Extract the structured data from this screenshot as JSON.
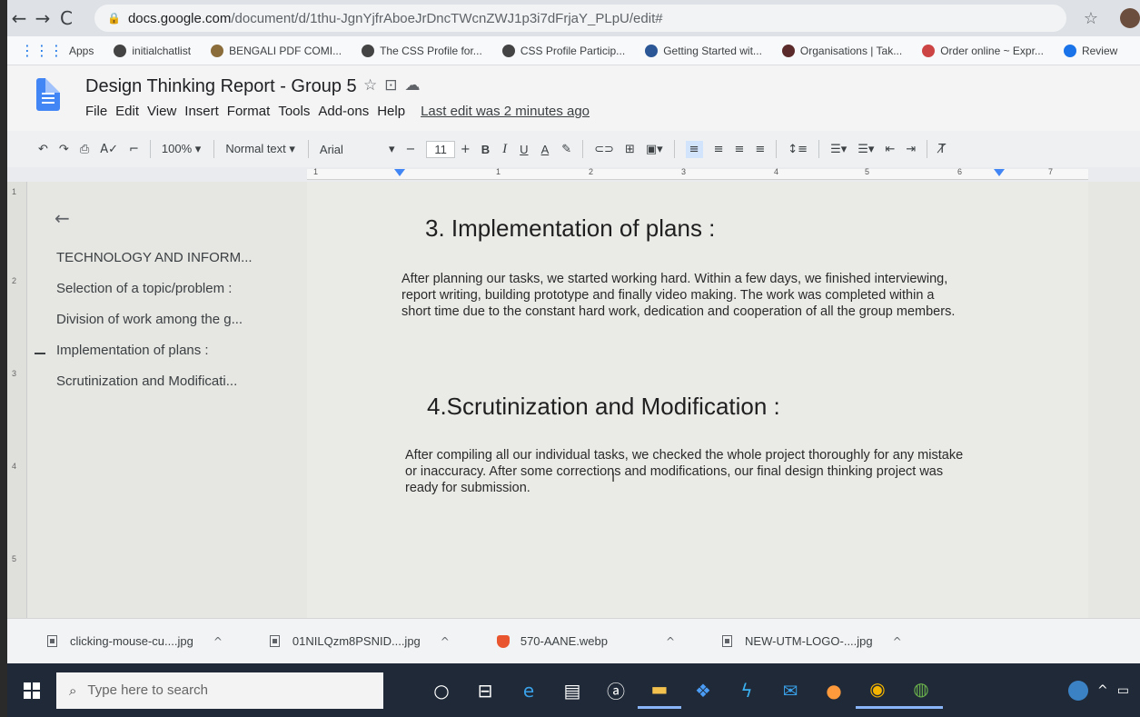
{
  "browser": {
    "url_host": "docs.google.com",
    "url_path": "/document/d/1thu-JgnYjfrAboeJrDncTWcnZWJ1p3i7dFrjaY_PLpU/edit#",
    "bookmarks": [
      {
        "label": "Apps",
        "icon": "apps-grid-icon"
      },
      {
        "label": "initialchatlist",
        "icon": "globe-icon"
      },
      {
        "label": "BENGALI PDF COMI...",
        "icon": "bookmark-icon"
      },
      {
        "label": "The CSS Profile for...",
        "icon": "globe-icon"
      },
      {
        "label": "CSS Profile Particip...",
        "icon": "globe-icon"
      },
      {
        "label": "Getting Started wit...",
        "icon": "bookmark-icon"
      },
      {
        "label": "Organisations | Tak...",
        "icon": "bookmark-icon"
      },
      {
        "label": "Order online ~ Expr...",
        "icon": "bookmark-icon"
      },
      {
        "label": "Review",
        "icon": "search-icon"
      }
    ]
  },
  "doc": {
    "title": "Design Thinking Report - Group 5",
    "menu": [
      "File",
      "Edit",
      "View",
      "Insert",
      "Format",
      "Tools",
      "Add-ons",
      "Help"
    ],
    "last_edit": "Last edit was 2 minutes ago"
  },
  "toolbar": {
    "zoom": "100%",
    "style": "Normal text",
    "font": "Arial",
    "font_size": "11",
    "bold": "B",
    "italic": "I",
    "underline": "U",
    "text_color": "A"
  },
  "ruler": {
    "numbers": [
      "1",
      "1",
      "2",
      "3",
      "4",
      "5",
      "6",
      "7"
    ]
  },
  "v_ruler": {
    "numbers": [
      "1",
      "2",
      "3",
      "4",
      "5"
    ]
  },
  "outline": {
    "items": [
      "TECHNOLOGY AND INFORM...",
      "Selection of a topic/problem :",
      "Division of work among the g...",
      "Implementation of plans :",
      "Scrutinization and Modificati..."
    ]
  },
  "content": {
    "h3": "3. Implementation of plans :",
    "p3_lines": [
      "After planning our tasks, we started working hard. Within a few days, we finished interviewing,",
      "report writing, building prototype and finally video making. The work was completed within a",
      "short time due to the constant hard work, dedication and cooperation of all the group members."
    ],
    "h4": "4.Scrutinization and Modification :",
    "p4_lines": [
      "After compiling all our individual tasks, we checked the whole project thoroughly for any mistake",
      "or inaccuracy. After some corrections and modifications, our final design thinking project was",
      "ready for submission."
    ]
  },
  "downloads": [
    {
      "name": "clicking-mouse-cu....jpg"
    },
    {
      "name": "01NILQzm8PSNID....jpg"
    },
    {
      "name": "570-AANE.webp"
    },
    {
      "name": "NEW-UTM-LOGO-....jpg"
    }
  ],
  "taskbar": {
    "search_placeholder": "Type here to search"
  }
}
